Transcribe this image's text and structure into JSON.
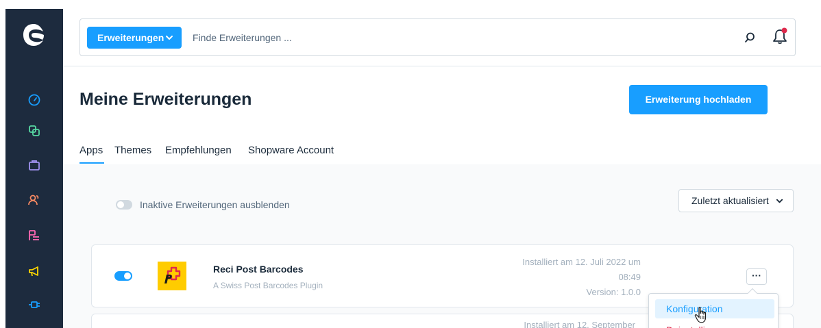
{
  "search": {
    "type_label": "Erweiterungen",
    "placeholder": "Finde Erweiterungen ..."
  },
  "page": {
    "title": "Meine Erweiterungen",
    "upload_label": "Erweiterung hochladen"
  },
  "tabs": [
    {
      "label": "Apps"
    },
    {
      "label": "Themes"
    },
    {
      "label": "Empfehlungen"
    },
    {
      "label": "Shopware Account"
    }
  ],
  "filter": {
    "toggle_label": "Inaktive Erweiterungen ausblenden",
    "sort_label": "Zuletzt aktualisiert"
  },
  "extensions": [
    {
      "name": "Reci Post Barcodes",
      "description": "A Swiss Post Barcodes Plugin",
      "installed_line1": "Installiert am 12. Juli 2022 um",
      "installed_line2": "08:49",
      "version": "Version: 1.0.0",
      "more_label": "···"
    },
    {
      "installed_line1": "Installiert am 12. September"
    }
  ],
  "context_menu": {
    "items": [
      {
        "label": "Konfiguration"
      },
      {
        "label": "Deinstallieren"
      }
    ]
  },
  "colors": {
    "primary": "#189eff",
    "sidebar": "#1d2b3e",
    "danger": "#de294c"
  },
  "icons": {
    "sidebar": [
      "dashboard-icon",
      "catalogue-icon",
      "orders-icon",
      "customers-icon",
      "content-icon",
      "marketing-icon",
      "extensions-icon"
    ]
  }
}
